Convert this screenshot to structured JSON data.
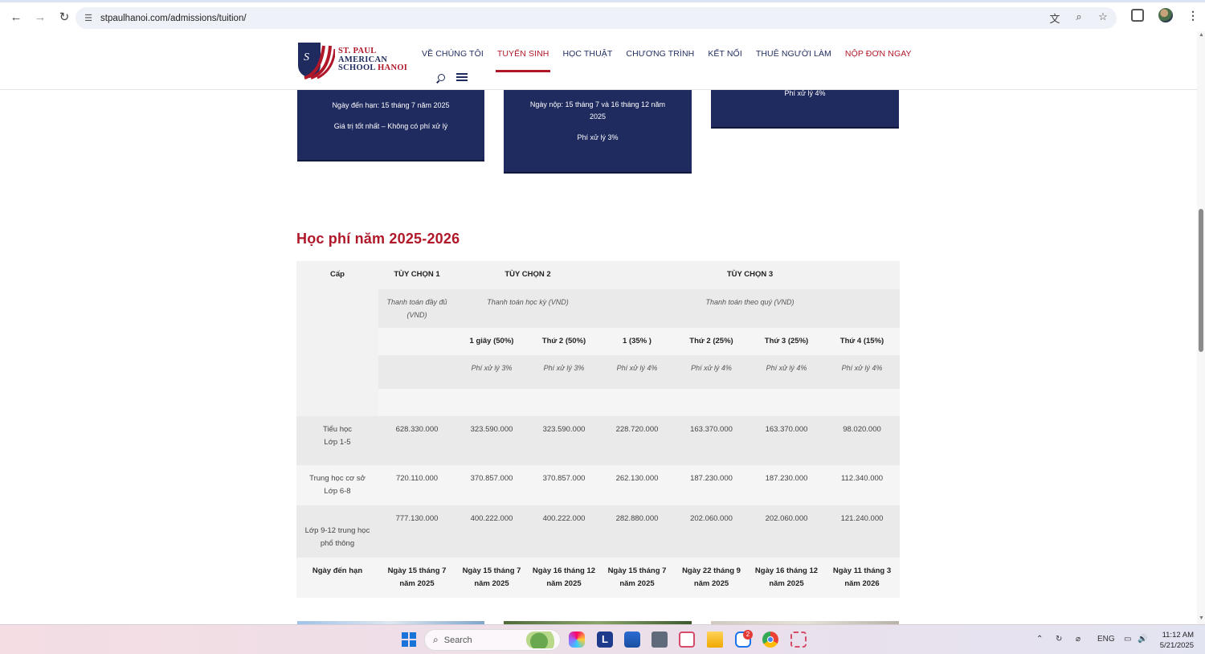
{
  "browser": {
    "url": "stpaulhanoi.com/admissions/tuition/"
  },
  "logo": {
    "line1": "ST. PAUL",
    "line2": "AMERICAN",
    "line3a": "SCHOOL",
    "line3b": "HANOI"
  },
  "nav": {
    "items": [
      {
        "label": "VỀ CHÚNG TÔI"
      },
      {
        "label": "TUYỂN SINH"
      },
      {
        "label": "HỌC THUẬT"
      },
      {
        "label": "CHƯƠNG TRÌNH"
      },
      {
        "label": "KẾT NỐI"
      },
      {
        "label": "THUÊ NGƯỜI LÀM"
      },
      {
        "label": "NỘP ĐƠN NGAY"
      }
    ]
  },
  "cards": {
    "card1": {
      "line1": "Ngày đến hạn: 15 tháng 7 năm 2025",
      "line2": "Giá trị tốt nhất – Không có phí xử lý"
    },
    "card2": {
      "line1": "Ngày nộp: 15 tháng 7 và 16 tháng 12 năm 2025",
      "line2": "Phí xử lý 3%"
    },
    "card3": {
      "line1": "Phí xử lý 4%"
    }
  },
  "section": {
    "title": "Học phí năm 2025-2026"
  },
  "table": {
    "cap_header": "Cấp",
    "option1": "TÙY CHỌN 1",
    "option2": "TÙY CHỌN 2",
    "option3": "TÙY CHỌN 3",
    "option1_desc": "Thanh toán đầy đủ (VND)",
    "option2_desc": "Thanh toán học kỳ (VND)",
    "option3_desc": "Thanh toán theo quý (VND)",
    "installments": [
      "1 giây  (50%)",
      "Thứ 2  (50%)",
      "1  (35% )",
      "Thứ 2  (25%)",
      "Thứ 3  (25%)",
      "Thứ 4  (15%)"
    ],
    "fees": [
      "Phí xử lý 3%",
      "Phí xử lý 3%",
      "Phí xử lý 4%",
      "Phí xử lý 4%",
      "Phí xử lý 4%",
      "Phí xử lý 4%"
    ],
    "rows": [
      {
        "level1": "Tiểu học",
        "level2": "Lớp 1-5",
        "values": [
          "628.330.000",
          "323.590.000",
          "323.590.000",
          "228.720.000",
          "163.370.000",
          "163.370.000",
          "98.020.000"
        ]
      },
      {
        "level1": "Trung học cơ sở",
        "level2": "Lớp 6-8",
        "values": [
          "720.110.000",
          "370.857.000",
          "370.857.000",
          "262.130.000",
          "187.230.000",
          "187.230.000",
          "112.340.000"
        ]
      },
      {
        "level1": "Lớp 9-12 trung học",
        "level2": "phổ thông",
        "values": [
          "777.130.000",
          "400.222.000",
          "400.222.000",
          "282.880.000",
          "202.060.000",
          "202.060.000",
          "121.240.000"
        ]
      }
    ],
    "due_label": "Ngày đến hạn",
    "due_dates": [
      [
        "Ngày 15 tháng 7",
        "năm 2025"
      ],
      [
        "Ngày 15 tháng 7",
        "năm 2025"
      ],
      [
        "Ngày 16 tháng 12",
        "năm 2025"
      ],
      [
        "Ngày 15 tháng 7",
        "năm 2025"
      ],
      [
        "Ngày 22 tháng 9",
        "năm 2025"
      ],
      [
        "Ngày 16 tháng 12",
        "năm 2025"
      ],
      [
        "Ngày 11 tháng 3",
        "năm 2026"
      ]
    ]
  },
  "taskbar": {
    "search_placeholder": "Search",
    "badge_count": "2",
    "lang": "ENG",
    "time": "11:12 AM",
    "date": "5/21/2025"
  },
  "colors": {
    "navy": "#1f2b5e",
    "crimson": "#b0182a"
  }
}
